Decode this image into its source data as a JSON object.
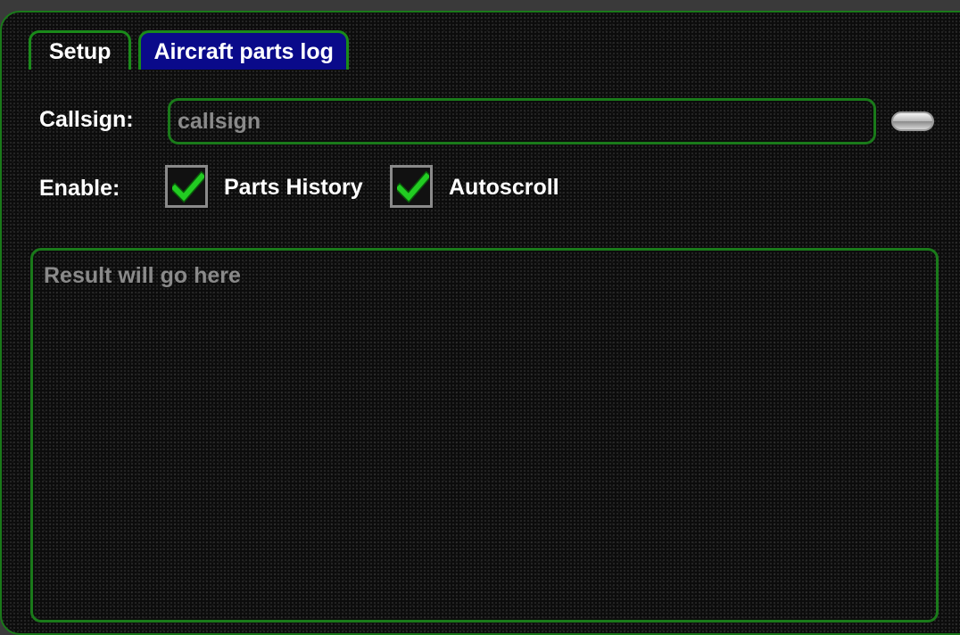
{
  "tabs": [
    {
      "label": "Setup",
      "active": false
    },
    {
      "label": "Aircraft parts log",
      "active": true
    }
  ],
  "callsign": {
    "label": "Callsign:",
    "value": "",
    "placeholder": "callsign"
  },
  "enable": {
    "label": "Enable:",
    "parts_history": {
      "label": "Parts History",
      "checked": true
    },
    "autoscroll": {
      "label": "Autoscroll",
      "checked": true
    }
  },
  "result": {
    "value": "",
    "placeholder": "Result will go here"
  },
  "colors": {
    "accent_green": "#1a7a1a",
    "active_tab": "#0a0a8a",
    "check_green": "#22cc22",
    "background": "#0c0c0c"
  },
  "icons": {
    "check": "checkmark-icon",
    "toggle": "pill-button-icon"
  }
}
